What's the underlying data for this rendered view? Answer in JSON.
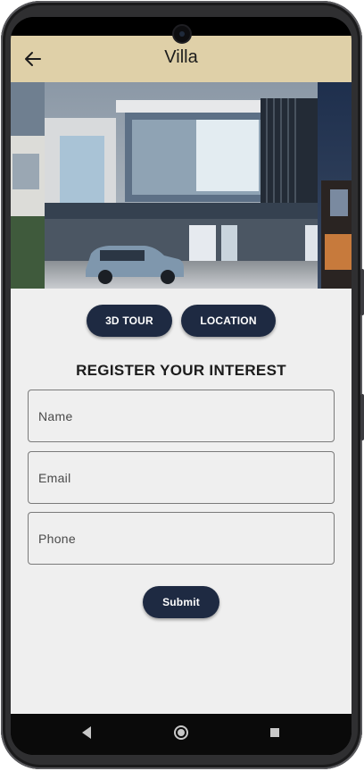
{
  "app": {
    "title": "Villa"
  },
  "actions": {
    "tour_label": "3D TOUR",
    "location_label": "LOCATION"
  },
  "form": {
    "heading": "REGISTER YOUR INTEREST",
    "name_placeholder": "Name",
    "email_placeholder": "Email",
    "phone_placeholder": "Phone",
    "submit_label": "Submit"
  },
  "icons": {
    "back": "arrow-left-icon",
    "nav_back": "triangle-back-icon",
    "nav_home": "circle-home-icon",
    "nav_recents": "square-recents-icon"
  },
  "colors": {
    "appbar": "#dfd0a8",
    "button": "#1e2a42",
    "background": "#efefef"
  }
}
